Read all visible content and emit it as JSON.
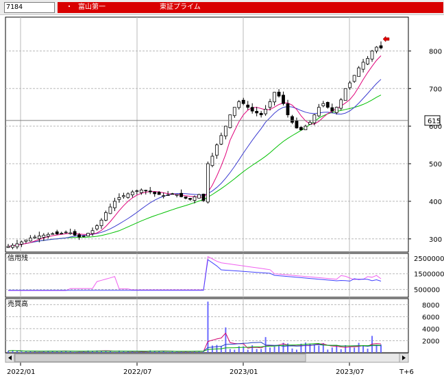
{
  "header": {
    "code": "7184",
    "bullet": "・",
    "company_name": "富山第一",
    "market": "東証プライム"
  },
  "price_panel": {
    "y_ticks": [
      "800",
      "700",
      "600",
      "500",
      "400",
      "300"
    ],
    "current_price_label": "615",
    "current_price": 615,
    "ylim": [
      265,
      890
    ]
  },
  "margin_panel": {
    "title": "信用残",
    "y_ticks": [
      "2500000",
      "1500000",
      "500000"
    ],
    "ylim": [
      0,
      2800000
    ]
  },
  "volume_panel": {
    "title": "売買高",
    "y_ticks": [
      "8000",
      "6000",
      "4000",
      "2000"
    ],
    "ylim": [
      0,
      9000
    ]
  },
  "x_axis": {
    "labels": [
      "2022/01",
      "2022/07",
      "2023/01",
      "2023/07",
      "T+6"
    ]
  },
  "colors": {
    "header_bg": "#d90000",
    "ma_short": "#e0007a",
    "ma_mid": "#3a3ad0",
    "ma_long": "#00c000",
    "arrow": "#e00000",
    "margin_buy": "#f060f0",
    "margin_sell": "#4040ff",
    "volume_bar": "#6a6aff"
  },
  "chart_data": {
    "type": "candlestick",
    "y_axis_range": [
      265,
      890
    ],
    "weekly_close_series": [
      280,
      283,
      287,
      292,
      297,
      302,
      305,
      308,
      310,
      312,
      314,
      313,
      315,
      318,
      316,
      310,
      305,
      308,
      315,
      322,
      335,
      350,
      370,
      385,
      400,
      410,
      415,
      420,
      425,
      428,
      430,
      428,
      425,
      420,
      418,
      415,
      417,
      420,
      418,
      412,
      408,
      405,
      412,
      418,
      402,
      500,
      520,
      550,
      575,
      600,
      630,
      650,
      665,
      660,
      650,
      640,
      635,
      630,
      645,
      665,
      690,
      680,
      660,
      630,
      610,
      595,
      590,
      600,
      610,
      630,
      650,
      660,
      650,
      640,
      650,
      670,
      700,
      715,
      735,
      755,
      770,
      780,
      800,
      810,
      808
    ]
  }
}
